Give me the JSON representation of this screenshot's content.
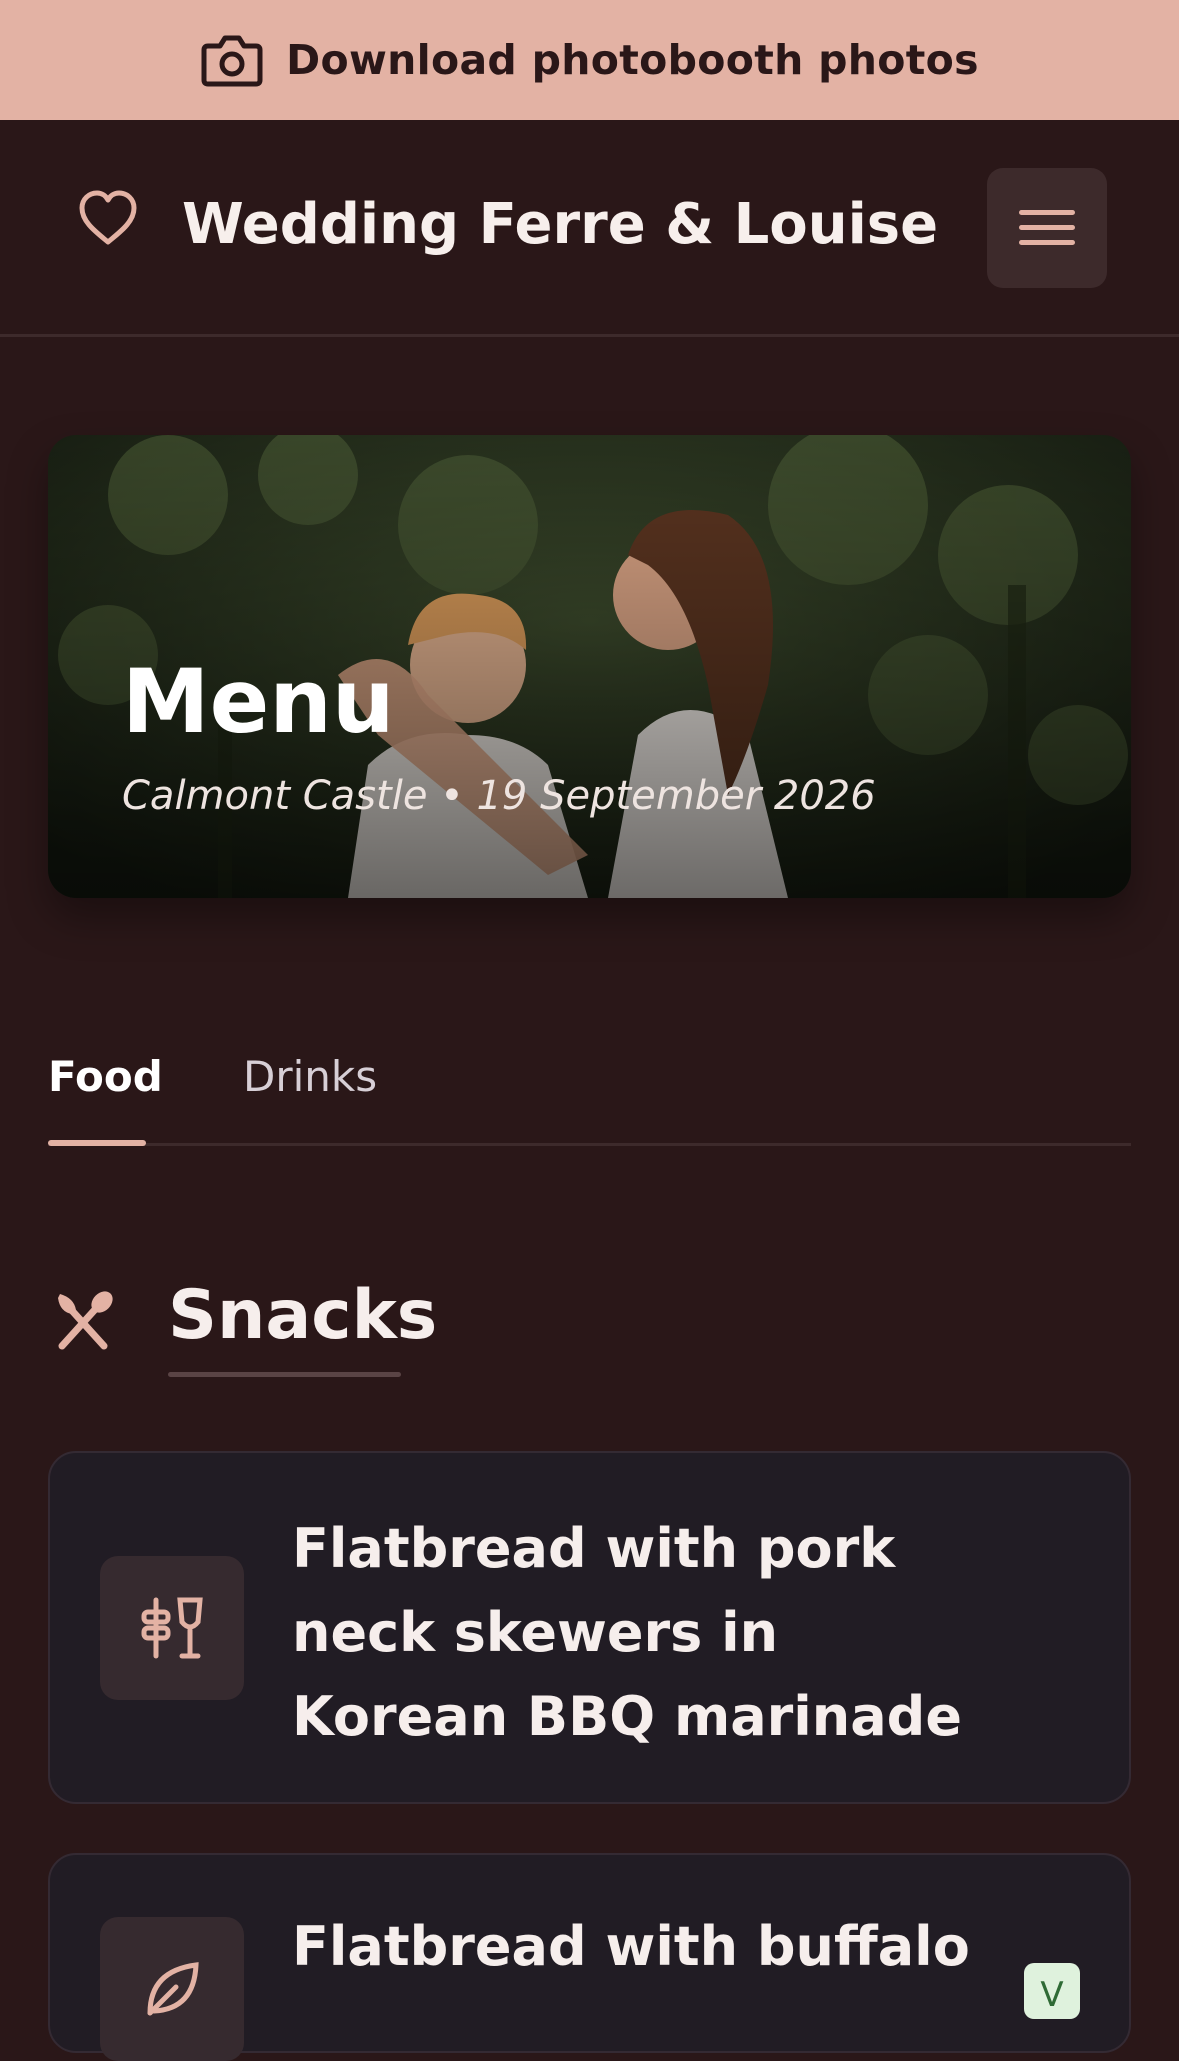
{
  "banner": {
    "label": "Download photobooth photos",
    "icon": "camera-icon"
  },
  "header": {
    "title": "Wedding Ferre & Louise",
    "logo_icon": "heart-icon",
    "menu_icon": "hamburger-icon"
  },
  "hero": {
    "title": "Menu",
    "subtitle": "Calmont Castle • 19 September 2026"
  },
  "tabs": [
    {
      "label": "Food",
      "active": true
    },
    {
      "label": "Drinks",
      "active": false
    }
  ],
  "section": {
    "title": "Snacks",
    "icon": "utensils-icon"
  },
  "items": [
    {
      "name": "Flatbread with pork neck skewers in Korean BBQ marinade",
      "icon": "skewer-wine-icon"
    },
    {
      "name": "Flatbread with buffalo",
      "icon": "leaf-icon",
      "badge": "V"
    }
  ],
  "colors": {
    "background": "#2a1718",
    "banner": "#e3b2a4",
    "accent": "#e3b2a4",
    "card": "#211c24"
  }
}
